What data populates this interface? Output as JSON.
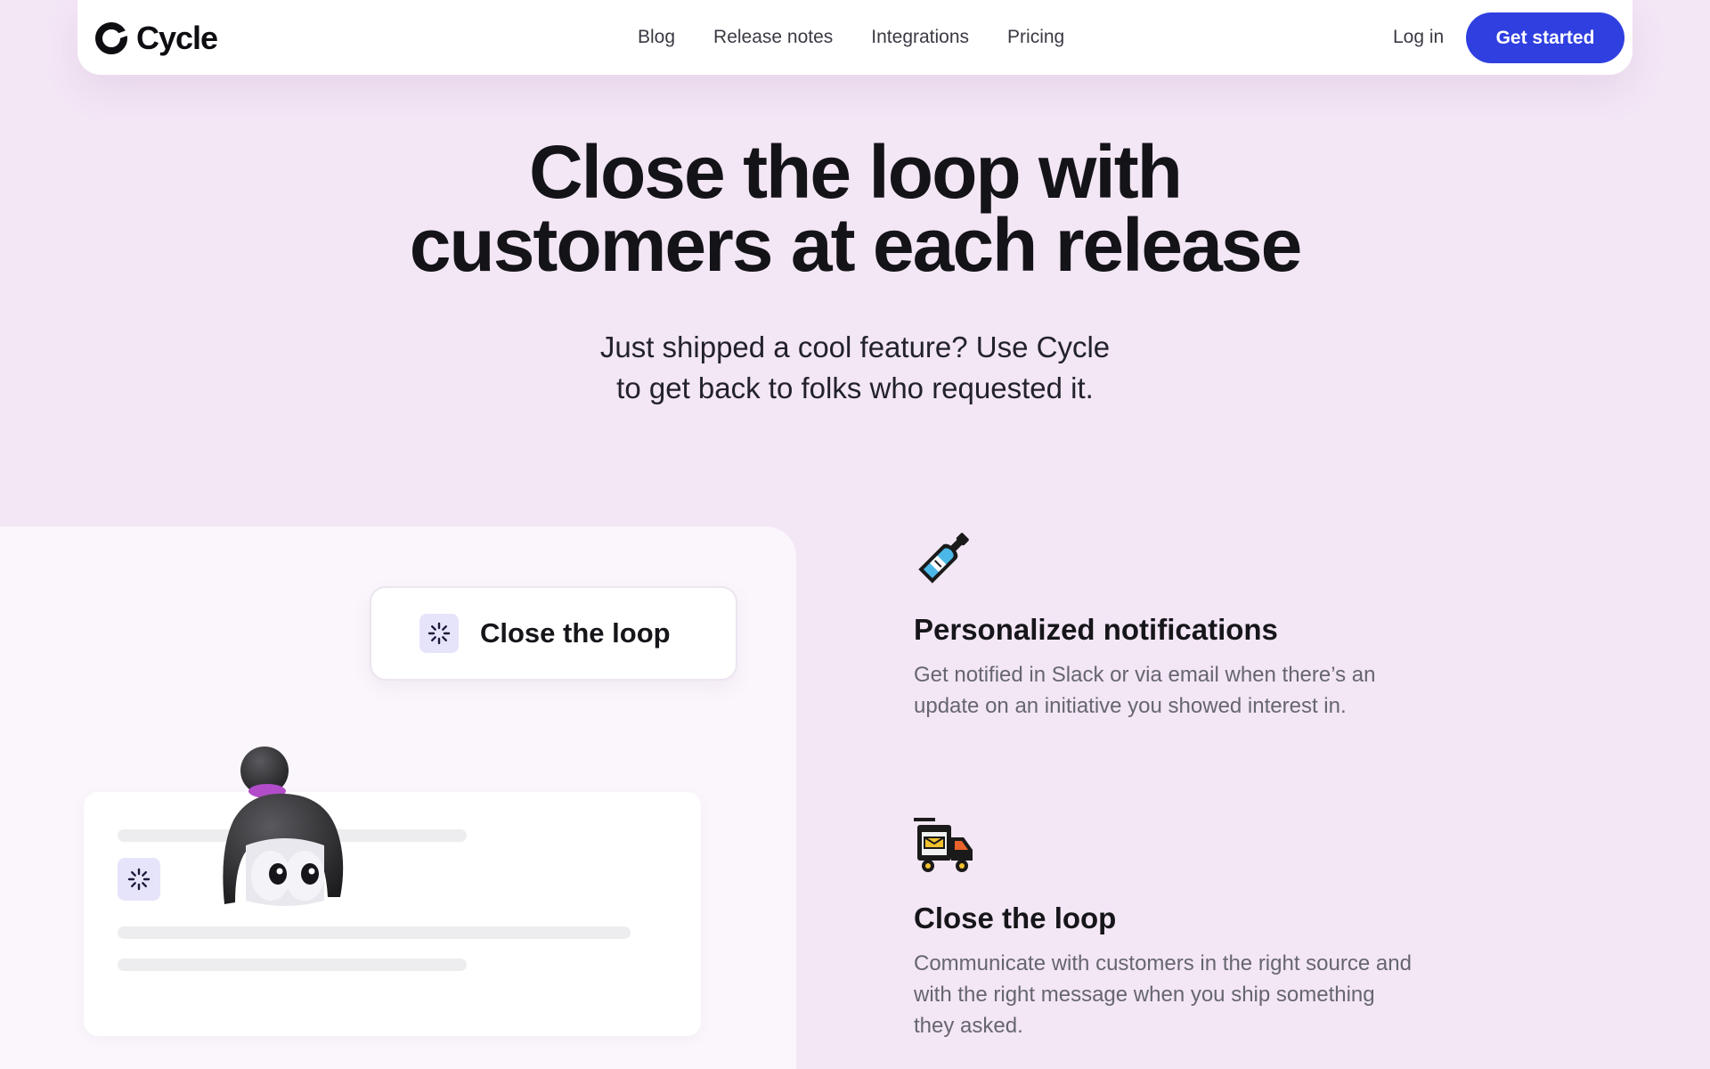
{
  "brand": {
    "name": "Cycle",
    "accent": "#2f3fe0",
    "background": "#f3e6f5"
  },
  "nav": {
    "links": [
      "Blog",
      "Release notes",
      "Integrations",
      "Pricing"
    ],
    "login": "Log in",
    "cta": "Get started"
  },
  "hero": {
    "title_line1": "Close the loop with",
    "title_line2": "customers at each release",
    "subtitle_line1": "Just shipped a cool feature? Use Cycle",
    "subtitle_line2": "to get back to folks who requested it."
  },
  "illustration": {
    "pill_label": "Close the loop",
    "pill_icon": "spinner-icon",
    "card_icon": "spinner-icon",
    "mascot": "mascot-avatar"
  },
  "features": [
    {
      "icon": "bottle-icon",
      "title": "Personalized notifications",
      "desc": "Get notified in Slack or via email when there’s an update on an initiative you showed interest in."
    },
    {
      "icon": "delivery-truck-icon",
      "title": "Close the loop",
      "desc": "Communicate with customers in the right source and with the right message when you ship something they asked."
    }
  ]
}
